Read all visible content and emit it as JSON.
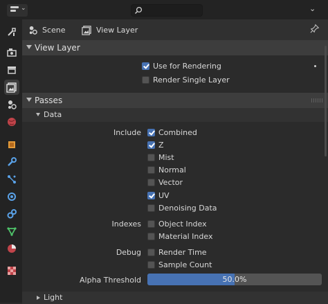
{
  "breadcrumb": {
    "scene": "Scene",
    "view_layer": "View Layer"
  },
  "sections": {
    "view_layer": {
      "title": "View Layer",
      "use_for_rendering": {
        "label": "Use for Rendering",
        "checked": true
      },
      "render_single_layer": {
        "label": "Render Single Layer",
        "checked": false
      }
    },
    "passes": {
      "title": "Passes",
      "data": {
        "title": "Data",
        "include_label": "Include",
        "include": [
          {
            "label": "Combined",
            "checked": true
          },
          {
            "label": "Z",
            "checked": true
          },
          {
            "label": "Mist",
            "checked": false
          },
          {
            "label": "Normal",
            "checked": false
          },
          {
            "label": "Vector",
            "checked": false
          },
          {
            "label": "UV",
            "checked": true
          },
          {
            "label": "Denoising Data",
            "checked": false
          }
        ],
        "indexes_label": "Indexes",
        "indexes": [
          {
            "label": "Object Index",
            "checked": false
          },
          {
            "label": "Material Index",
            "checked": false
          }
        ],
        "debug_label": "Debug",
        "debug": [
          {
            "label": "Render Time",
            "checked": false
          },
          {
            "label": "Sample Count",
            "checked": false
          }
        ],
        "alpha_threshold": {
          "label": "Alpha Threshold",
          "value": "50.0%",
          "fraction": 0.5
        }
      },
      "light": {
        "title": "Light"
      }
    }
  },
  "colors": {
    "accent": "#4772b3",
    "panel_bg": "#2b2b2b",
    "header_bg": "#3d3d3d"
  },
  "sidebar_tabs": [
    "tool-icon",
    "render-icon",
    "output-icon",
    "view-layer-icon",
    "scene-icon",
    "world-icon",
    "object-icon",
    "modifier-icon",
    "particles-icon",
    "physics-icon",
    "constraints-icon",
    "object-data-icon",
    "material-icon",
    "texture-icon"
  ]
}
